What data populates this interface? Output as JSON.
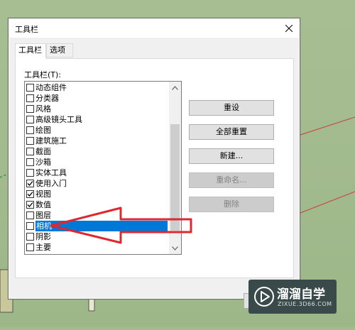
{
  "dialog": {
    "title": "工具栏",
    "tabs": [
      {
        "label": "工具栏"
      },
      {
        "label": "选项"
      }
    ],
    "list_label": "工具栏(T):",
    "toolbars": [
      {
        "label": "动态组件",
        "checked": false
      },
      {
        "label": "分类器",
        "checked": false
      },
      {
        "label": "风格",
        "checked": false
      },
      {
        "label": "高级镜头工具",
        "checked": false
      },
      {
        "label": "绘图",
        "checked": false
      },
      {
        "label": "建筑施工",
        "checked": false
      },
      {
        "label": "截面",
        "checked": false
      },
      {
        "label": "沙箱",
        "checked": false
      },
      {
        "label": "实体工具",
        "checked": false
      },
      {
        "label": "使用入门",
        "checked": true
      },
      {
        "label": "视图",
        "checked": true
      },
      {
        "label": "数值",
        "checked": true
      },
      {
        "label": "图层",
        "checked": false
      },
      {
        "label": "相机",
        "checked": false,
        "selected": true
      },
      {
        "label": "阴影",
        "checked": false
      },
      {
        "label": "主要",
        "checked": false
      }
    ],
    "buttons": {
      "reset": "重设",
      "reset_all": "全部重置",
      "new": "新建...",
      "rename": "重命名...",
      "delete": "删除"
    }
  },
  "watermark": {
    "name": "溜溜自学",
    "url": "ZIXUE.3D66.COM"
  },
  "colors": {
    "selection": "#0078d7",
    "annotation_arrow": "#e0262f"
  }
}
